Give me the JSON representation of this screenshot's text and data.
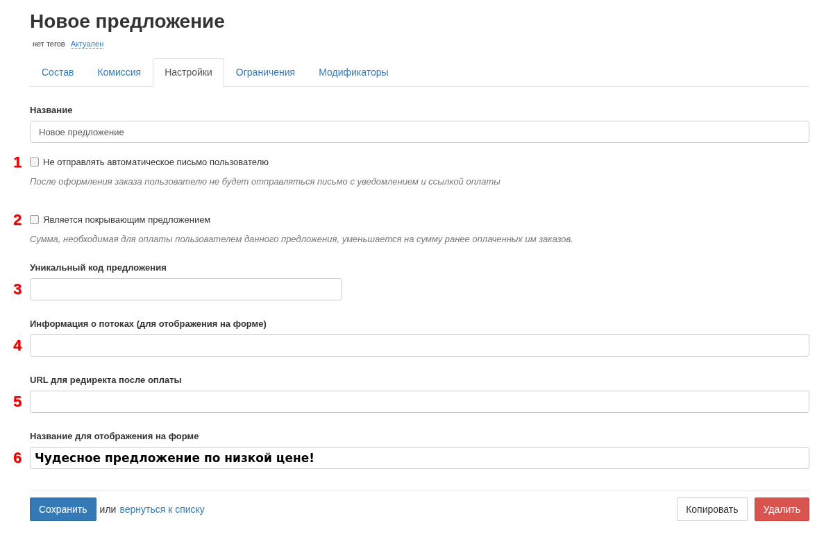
{
  "title": "Новое предложение",
  "tags": {
    "none_label": "нет тегов",
    "status_link": "Актуален"
  },
  "tabs": [
    {
      "label": "Состав",
      "selected": false
    },
    {
      "label": "Комиссия",
      "selected": false
    },
    {
      "label": "Настройки",
      "selected": true
    },
    {
      "label": "Ограничения",
      "selected": false
    },
    {
      "label": "Модификаторы",
      "selected": false
    }
  ],
  "fields": [
    {
      "kind": "text",
      "label": "Название",
      "value": "Новое предложение"
    },
    {
      "kind": "checkbox",
      "marker": "1",
      "label": "Не отправлять автоматическое письмо пользователю",
      "checked": false,
      "hint": "После оформления заказа пользователю не будет отправляться письмо с уведомлением и ссылкой оплаты"
    },
    {
      "kind": "checkbox",
      "marker": "2",
      "label": "Является покрывающим предложением",
      "checked": false,
      "hint": "Сумма, необходимая для оплаты пользователем данного предложения, уменьшается на сумму ранее оплаченных им заказов."
    },
    {
      "kind": "short_text",
      "marker": "3",
      "label": "Уникальный код предложения"
    },
    {
      "kind": "text",
      "marker": "4",
      "label": "Информация о потоках (для отображения на форме)"
    },
    {
      "kind": "text",
      "marker": "5",
      "label": "URL для редиректа после оплаты"
    },
    {
      "kind": "text",
      "marker": "6",
      "label": "Название для отображения на форме",
      "value": "Чудесное предложение по низкой цене!",
      "emphasis": true
    }
  ],
  "footer": {
    "save": "Сохранить",
    "or": "или",
    "back_link": "вернуться к списку",
    "copy": "Копировать",
    "delete": "Удалить"
  }
}
